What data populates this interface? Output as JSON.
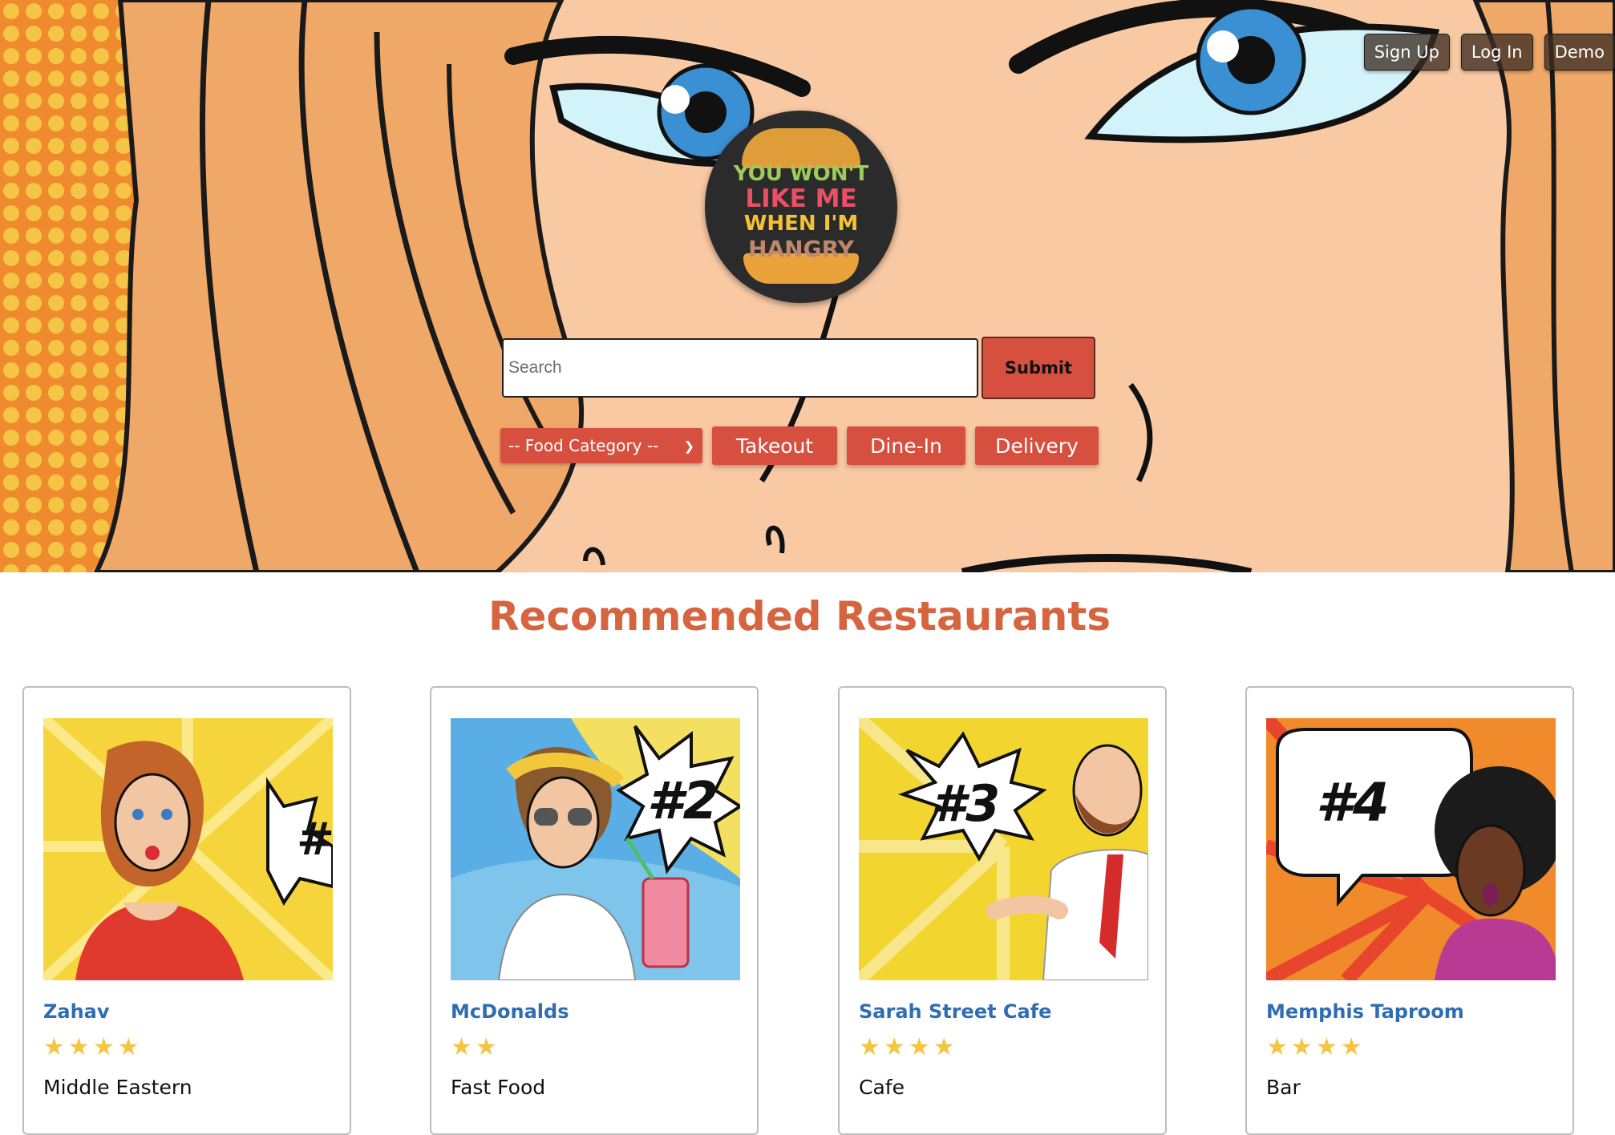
{
  "nav": {
    "signup": "Sign Up",
    "login": "Log In",
    "demo": "Demo"
  },
  "logo": {
    "line1": "YOU WON'T",
    "line2": "LIKE ME",
    "line3": "WHEN I'M",
    "line4": "HANGRY"
  },
  "search": {
    "placeholder": "Search",
    "value": "",
    "submit_label": "Submit"
  },
  "filters": {
    "category_selected": "-- Food Category --",
    "takeout": "Takeout",
    "dinein": "Dine-In",
    "delivery": "Delivery"
  },
  "recommended": {
    "title": "Recommended Restaurants",
    "cards": [
      {
        "name": "Zahav",
        "rating": 4,
        "category": "Middle Eastern",
        "badge": "#",
        "accent": "#e03a2f"
      },
      {
        "name": "McDonalds",
        "rating": 2,
        "category": "Fast Food",
        "badge": "#2",
        "accent": "#f2d64b"
      },
      {
        "name": "Sarah Street Cafe",
        "rating": 4,
        "category": "Cafe",
        "badge": "#3",
        "accent": "#f3d52f"
      },
      {
        "name": "Memphis Taproom",
        "rating": 4,
        "category": "Bar",
        "badge": "#4",
        "accent": "#e8462c"
      }
    ]
  },
  "colors": {
    "brand_red": "#d7503f",
    "title_orange": "#d5643f",
    "link_blue": "#2f6db2",
    "star_gold": "#f5c542"
  }
}
